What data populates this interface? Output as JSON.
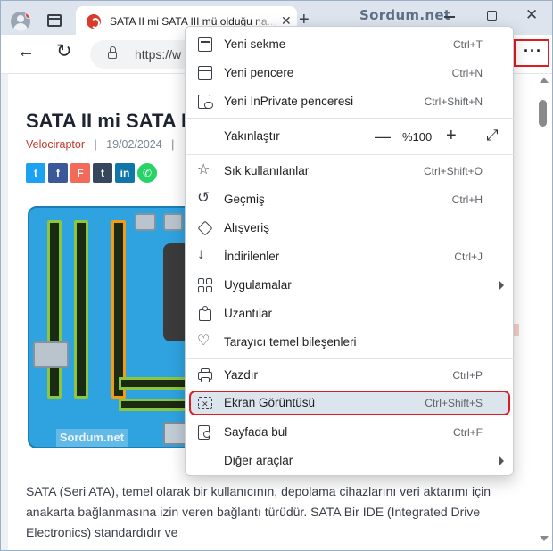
{
  "browser": {
    "tab_title": "SATA II mi SATA III mü olduğu na...",
    "newtab_symbol": "+",
    "watermark": "Sordum.net",
    "url": "https://w",
    "more_symbol": "···"
  },
  "article": {
    "title": "SATA II mi SATA III",
    "author": "Velociraptor",
    "date": "19/02/2024",
    "separator": "|",
    "image_watermark": "Sordum.net",
    "paragraph": "SATA (Seri ATA), temel olarak bir kullanıcının, depolama cihazlarını veri aktarımı için anakarta bağlanmasına izin veren bağlantı türüdür. SATA Bir IDE (Integrated Drive Electronics) standardıdır ve",
    "share_icons": [
      "twitter-icon",
      "facebook-icon",
      "flipboard-icon",
      "tumblr-icon",
      "linkedin-icon",
      "whatsapp-icon"
    ]
  },
  "menu": {
    "items": [
      {
        "label": "Yeni sekme",
        "shortcut": "Ctrl+T",
        "icon": "new-tab-icon"
      },
      {
        "label": "Yeni pencere",
        "shortcut": "Ctrl+N",
        "icon": "new-window-icon"
      },
      {
        "label": "Yeni InPrivate penceresi",
        "shortcut": "Ctrl+Shift+N",
        "icon": "inprivate-icon"
      },
      {
        "label": "Yakınlaştır",
        "shortcut": "",
        "icon": ""
      },
      {
        "label": "Sık kullanılanlar",
        "shortcut": "Ctrl+Shift+O",
        "icon": "favorites-icon"
      },
      {
        "label": "Geçmiş",
        "shortcut": "Ctrl+H",
        "icon": "history-icon"
      },
      {
        "label": "Alışveriş",
        "shortcut": "",
        "icon": "shopping-tag-icon"
      },
      {
        "label": "İndirilenler",
        "shortcut": "Ctrl+J",
        "icon": "download-icon"
      },
      {
        "label": "Uygulamalar",
        "shortcut": "",
        "icon": "apps-icon",
        "submenu": true
      },
      {
        "label": "Uzantılar",
        "shortcut": "",
        "icon": "extensions-puzzle-icon"
      },
      {
        "label": "Tarayıcı temel bileşenleri",
        "shortcut": "",
        "icon": "browser-essentials-heart-icon"
      },
      {
        "label": "Yazdır",
        "shortcut": "Ctrl+P",
        "icon": "printer-icon"
      },
      {
        "label": "Ekran Görüntüsü",
        "shortcut": "Ctrl+Shift+S",
        "icon": "screenshot-icon",
        "highlighted": true
      },
      {
        "label": "Sayfada bul",
        "shortcut": "Ctrl+F",
        "icon": "find-on-page-icon"
      },
      {
        "label": "Diğer araçlar",
        "shortcut": "",
        "icon": "",
        "submenu": true
      }
    ],
    "zoom": {
      "minus": "—",
      "value": "%100",
      "plus": "+",
      "fullscreen": "⤢"
    }
  },
  "colors": {
    "highlight_border": "#e11b22",
    "author": "#c0392b",
    "titlebar": "#dde4ee"
  }
}
